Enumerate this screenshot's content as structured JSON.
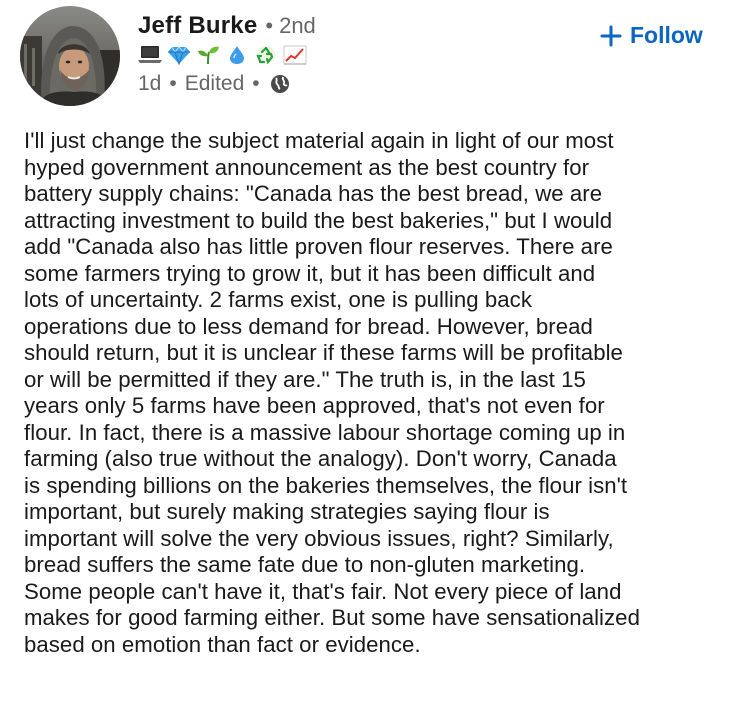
{
  "author": {
    "name": "Jeff Burke",
    "separator": "•",
    "degree": "2nd",
    "emojis": [
      "laptop-icon",
      "gem-icon",
      "seedling-icon",
      "droplet-icon",
      "recycle-icon",
      "chart-increasing-icon"
    ]
  },
  "meta": {
    "time": "1d",
    "separator": "•",
    "edited": "Edited",
    "separator2": "•",
    "visibility_icon": "globe-icon"
  },
  "follow": {
    "icon": "plus-icon",
    "label": "Follow",
    "color": "#0a66c2"
  },
  "post": {
    "lines": [
      "I'll just change the subject material again in light of our most",
      "hyped government announcement as the best country for",
      "battery supply chains: \"Canada has the best bread, we are",
      "attracting investment to build the best bakeries,\" but I would",
      "add \"Canada also has little proven flour reserves. There are",
      "some farmers trying to grow it, but it has been difficult and",
      "lots of uncertainty. 2 farms exist, one is pulling back",
      "operations due to less demand for bread. However, bread",
      "should return, but it is unclear if these farms will be profitable",
      "or will be permitted if they are.\" The truth is, in the last 15",
      "years only 5 farms have been approved, that's not even for",
      "flour. In fact, there is a massive labour shortage coming up in",
      "farming (also true without the analogy). Don't worry, Canada",
      "is spending billions on the bakeries themselves, the flour isn't",
      "important, but surely making strategies saying flour is",
      "important will solve the very obvious issues, right? Similarly,",
      "bread suffers the same fate due to non-gluten marketing.",
      "Some people can't have it, that's fair. Not every piece of land",
      "makes for good farming either. But some have sensationalized",
      "based on emotion than fact or evidence."
    ]
  }
}
